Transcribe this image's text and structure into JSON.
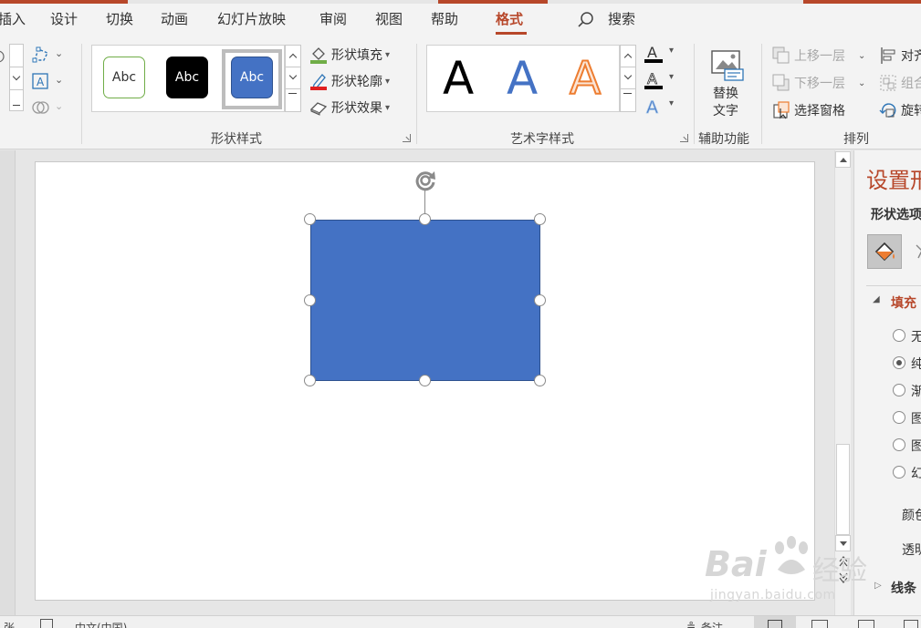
{
  "tabs": [
    {
      "label": "插入"
    },
    {
      "label": "设计"
    },
    {
      "label": "切换"
    },
    {
      "label": "动画"
    },
    {
      "label": "幻灯片放映"
    },
    {
      "label": "审阅"
    },
    {
      "label": "视图"
    },
    {
      "label": "帮助"
    },
    {
      "label": "格式",
      "active": true
    }
  ],
  "search": {
    "label": "搜索"
  },
  "ribbon": {
    "shape_styles": {
      "label": "形状样式",
      "presets": [
        "Abc",
        "Abc",
        "Abc"
      ],
      "fill": "形状填充",
      "outline": "形状轮廓",
      "effects": "形状效果"
    },
    "wordart": {
      "label": "艺术字样式",
      "presets": [
        "A",
        "A",
        "A"
      ]
    },
    "accessibility": {
      "label": "辅助功能",
      "alt_text_line1": "替换",
      "alt_text_line2": "文字"
    },
    "arrange": {
      "label": "排列",
      "bring_forward": "上移一层",
      "send_backward": "下移一层",
      "selection_pane": "选择窗格",
      "align": "对齐",
      "group": "组合",
      "rotate": "旋转"
    }
  },
  "pane": {
    "title": "设置形",
    "tab_label": "形状选项",
    "section_fill": "填充",
    "options": [
      "无",
      "纯",
      "渐",
      "图",
      "图",
      "幻"
    ],
    "selected_option_index": 1,
    "color_label": "颜色",
    "transparency_label": "透明",
    "section_line": "线条"
  },
  "statusbar": {
    "slide_info": "张",
    "language": "中文(中国)",
    "notes": "备注"
  },
  "watermark": {
    "brand": "Bai",
    "brand_cn": "经验",
    "url": "jingyan.baidu.com"
  },
  "colors": {
    "accent": "#b7472a",
    "shape_fill": "#4472c4",
    "shape_border": "#2f528f",
    "green_outline": "#70ad47",
    "orange_wordart": "#ed7d31"
  }
}
